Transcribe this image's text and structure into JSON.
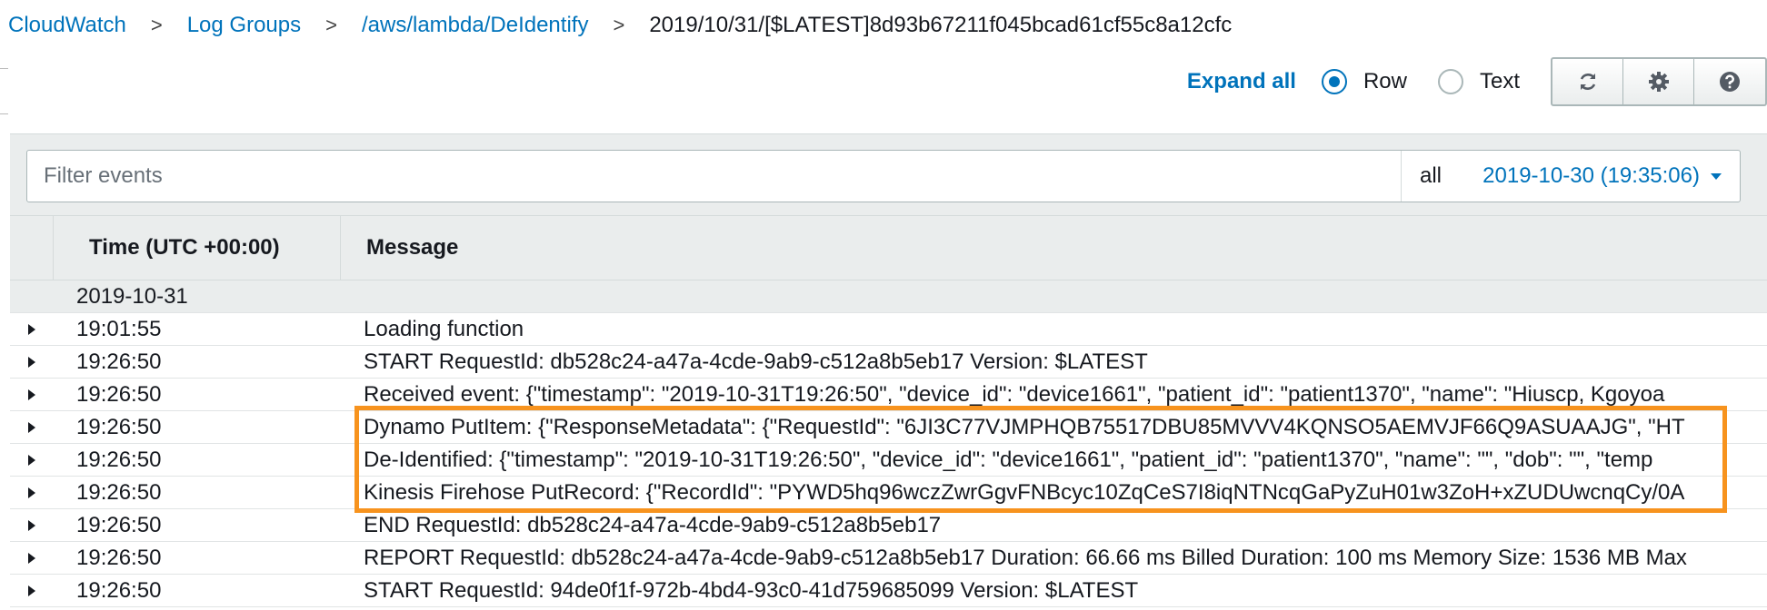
{
  "breadcrumb": {
    "items": [
      "CloudWatch",
      "Log Groups",
      "/aws/lambda/DeIdentify"
    ],
    "current": "2019/10/31/[$LATEST]8d93b67211f045bcad61cf55c8a12cfc",
    "separator": ">"
  },
  "toolbar": {
    "expand_label": "Expand all",
    "view_options": [
      {
        "label": "Row",
        "selected": true
      },
      {
        "label": "Text",
        "selected": false
      }
    ],
    "icons": [
      "refresh-icon",
      "gear-icon",
      "help-icon"
    ]
  },
  "filter": {
    "placeholder": "Filter events",
    "range_label": "all",
    "range_value": "2019-10-30 (19:35:06)"
  },
  "table": {
    "columns": [
      "Time (UTC +00:00)",
      "Message"
    ],
    "date_group": "2019-10-31",
    "rows": [
      {
        "time": "19:01:55",
        "message": "Loading function"
      },
      {
        "time": "19:26:50",
        "message": "START RequestId: db528c24-a47a-4cde-9ab9-c512a8b5eb17 Version: $LATEST"
      },
      {
        "time": "19:26:50",
        "message": "Received event: {\"timestamp\": \"2019-10-31T19:26:50\", \"device_id\": \"device1661\", \"patient_id\": \"patient1370\", \"name\": \"Hiuscp, Kgoyoa"
      },
      {
        "time": "19:26:50",
        "message": "Dynamo PutItem: {\"ResponseMetadata\": {\"RequestId\": \"6JI3C77VJMPHQB75517DBU85MVVV4KQNSO5AEMVJF66Q9ASUAAJG\", \"HT"
      },
      {
        "time": "19:26:50",
        "message": "De-Identified: {\"timestamp\": \"2019-10-31T19:26:50\", \"device_id\": \"device1661\", \"patient_id\": \"patient1370\", \"name\": \"\", \"dob\": \"\", \"temp"
      },
      {
        "time": "19:26:50",
        "message": "Kinesis Firehose PutRecord: {\"RecordId\": \"PYWD5hq96wczZwrGgvFNBcyc10ZqCeS7I8iqNTNcqGaPyZuH01w3ZoH+xZUDUwcnqCy/0A"
      },
      {
        "time": "19:26:50",
        "message": "END RequestId: db528c24-a47a-4cde-9ab9-c512a8b5eb17"
      },
      {
        "time": "19:26:50",
        "message": "REPORT RequestId: db528c24-a47a-4cde-9ab9-c512a8b5eb17 Duration: 66.66 ms Billed Duration: 100 ms Memory Size: 1536 MB Max"
      },
      {
        "time": "19:26:50",
        "message": "START RequestId: 94de0f1f-972b-4bd4-93c0-41d759685099 Version: $LATEST"
      }
    ]
  },
  "colors": {
    "link": "#0073bb",
    "highlight": "#f7931e",
    "panel": "#eaeded"
  }
}
